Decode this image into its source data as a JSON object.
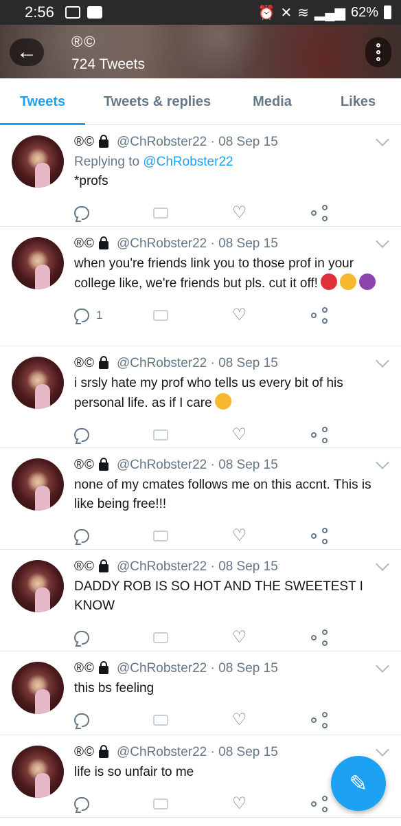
{
  "status_bar": {
    "time": "2:56",
    "battery": "62%"
  },
  "header": {
    "title": "®©",
    "subtitle": "724 Tweets"
  },
  "tabs": [
    {
      "label": "Tweets",
      "active": true
    },
    {
      "label": "Tweets & replies",
      "active": false
    },
    {
      "label": "Media",
      "active": false
    },
    {
      "label": "Likes",
      "active": false
    }
  ],
  "tweets": [
    {
      "name": "®©",
      "handle": "@ChRobster22",
      "date": "· 08 Sep 15",
      "reply_prefix": "Replying to",
      "reply_to": "@ChRobster22",
      "text": "*profs",
      "reply_count": ""
    },
    {
      "name": "®©",
      "handle": "@ChRobster22",
      "date": "· 08 Sep 15",
      "text": "when you're friends link you to those prof in your college like,  we're friends but pls. cut it off!",
      "emojis": [
        "#e0303a",
        "#f5b82e",
        "#8e44ad"
      ],
      "reply_count": "1"
    },
    {
      "name": "®©",
      "handle": "@ChRobster22",
      "date": "· 08 Sep 15",
      "text": "i srsly hate my prof who tells us every bit of his personal life. as if I care",
      "emojis": [
        "#f5b82e"
      ],
      "reply_count": ""
    },
    {
      "name": "®©",
      "handle": "@ChRobster22",
      "date": "· 08 Sep 15",
      "text": "none of my cmates follows me on this accnt. This is like being free!!!",
      "reply_count": ""
    },
    {
      "name": "®©",
      "handle": "@ChRobster22",
      "date": "· 08 Sep 15",
      "text": "DADDY ROB IS SO HOT AND THE SWEETEST I KNOW",
      "reply_count": ""
    },
    {
      "name": "®©",
      "handle": "@ChRobster22",
      "date": "· 08 Sep 15",
      "text": "this bs feeling",
      "reply_count": ""
    },
    {
      "name": "®©",
      "handle": "@ChRobster22",
      "date": "· 08 Sep 15",
      "text": "life is so unfair to me",
      "reply_count": ""
    }
  ],
  "colors": {
    "accent": "#1da1f2",
    "muted": "#657786",
    "text": "#14171a"
  }
}
